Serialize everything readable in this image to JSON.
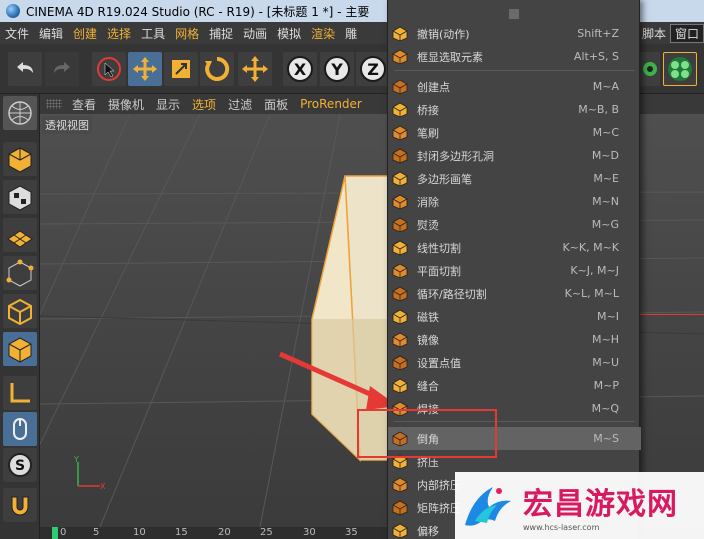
{
  "titlebar": {
    "title": "CINEMA 4D R19.024 Studio (RC - R19) - [未标题 1 *] - 主要"
  },
  "menubar": {
    "items": [
      "文件",
      "编辑",
      "创建",
      "选择",
      "工具",
      "网格",
      "捕捉",
      "动画",
      "模拟",
      "渲染",
      "雕"
    ],
    "highlighted": [
      "创建",
      "选择",
      "网格",
      "渲染"
    ],
    "right_items": [
      "脚本",
      "窗口"
    ]
  },
  "viewport": {
    "menu": [
      "查看",
      "摄像机",
      "显示",
      "选项",
      "过滤",
      "面板",
      "ProRender"
    ],
    "label": "透视视图"
  },
  "timeline": {
    "ticks": [
      "0",
      "5",
      "10",
      "15",
      "20",
      "25",
      "30",
      "35"
    ]
  },
  "dropdown": {
    "items": [
      {
        "label": "撤销(动作)",
        "shortcut": "Shift+Z",
        "icon": "undo-icon"
      },
      {
        "label": "框显选取元素",
        "shortcut": "Alt+S, S",
        "icon": "frame-selection-icon"
      },
      {
        "label": "创建点",
        "shortcut": "M~A",
        "icon": "create-point-icon"
      },
      {
        "label": "桥接",
        "shortcut": "M~B, B",
        "icon": "bridge-icon"
      },
      {
        "label": "笔刷",
        "shortcut": "M~C",
        "icon": "brush-icon"
      },
      {
        "label": "封闭多边形孔洞",
        "shortcut": "M~D",
        "icon": "close-hole-icon"
      },
      {
        "label": "多边形画笔",
        "shortcut": "M~E",
        "icon": "polygon-pen-icon"
      },
      {
        "label": "消除",
        "shortcut": "M~N",
        "icon": "dissolve-icon"
      },
      {
        "label": "熨烫",
        "shortcut": "M~G",
        "icon": "iron-icon"
      },
      {
        "label": "线性切割",
        "shortcut": "K~K, M~K",
        "icon": "line-cut-icon"
      },
      {
        "label": "平面切割",
        "shortcut": "K~J, M~J",
        "icon": "plane-cut-icon"
      },
      {
        "label": "循环/路径切割",
        "shortcut": "K~L, M~L",
        "icon": "loop-cut-icon"
      },
      {
        "label": "磁铁",
        "shortcut": "M~I",
        "icon": "magnet-icon"
      },
      {
        "label": "镜像",
        "shortcut": "M~H",
        "icon": "mirror-icon"
      },
      {
        "label": "设置点值",
        "shortcut": "M~U",
        "icon": "set-point-value-icon"
      },
      {
        "label": "缝合",
        "shortcut": "M~P",
        "icon": "stitch-icon"
      },
      {
        "label": "焊接",
        "shortcut": "M~Q",
        "icon": "weld-icon"
      },
      {
        "label": "倒角",
        "shortcut": "M~S",
        "icon": "bevel-icon"
      },
      {
        "label": "挤压",
        "shortcut": "",
        "icon": "extrude-icon"
      },
      {
        "label": "内部挤压",
        "shortcut": "",
        "icon": "extrude-inner-icon"
      },
      {
        "label": "矩阵挤压",
        "shortcut": "",
        "icon": "matrix-extrude-icon"
      },
      {
        "label": "偏移",
        "shortcut": "",
        "icon": "offset-icon"
      }
    ]
  },
  "watermark": {
    "main": "宏昌游戏网",
    "url": "www.hcs-laser.com"
  },
  "colors": {
    "accent": "#f2b134",
    "selected": "#4a6f97",
    "annotation": "#e53935",
    "watermark": "#d81b60"
  }
}
